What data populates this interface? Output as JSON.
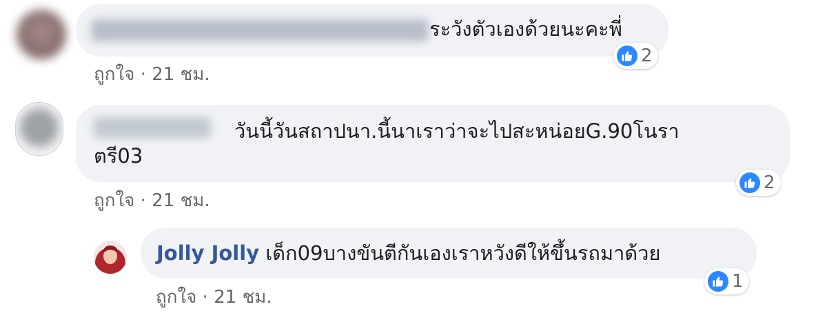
{
  "comments": [
    {
      "text": "ระวังตัวเองด้วยนะคะพี่",
      "reaction_count": "2",
      "like_label": "ถูกใจ",
      "time": "21 ชม."
    },
    {
      "text_line1": "วันนี้วันสถาปนา.นี้นาเราว่าจะไปสะหน่อยG.90โนรา",
      "text_line2": "ตรี03",
      "reaction_count": "2",
      "like_label": "ถูกใจ",
      "time": "21 ชม."
    }
  ],
  "reply": {
    "author": "Jolly Jolly",
    "text": "เด็ก09บางขันตีกันเองเราหวังดีให้ขึ้นรถมาด้วย",
    "reaction_count": "1",
    "like_label": "ถูกใจ",
    "time": "21 ชม."
  },
  "separator": " · ",
  "colors": {
    "bubble": "#f0f2f5",
    "author_link": "#365899",
    "like_reaction": "#2d88ff",
    "meta_text": "#65676b"
  },
  "icons": {
    "reaction": "thumbs-up-icon"
  }
}
